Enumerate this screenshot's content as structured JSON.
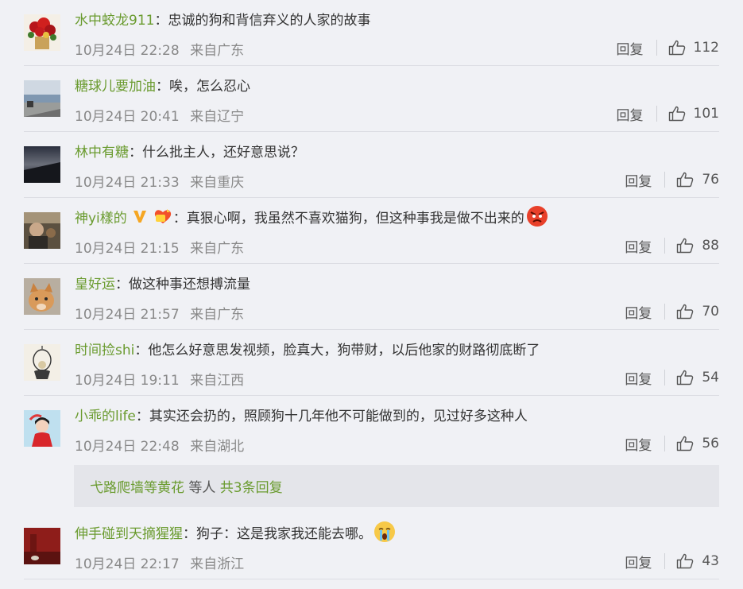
{
  "comments": [
    {
      "user": "水中蛟龙911",
      "text": "：忠诚的狗和背信弃义的人家的故事",
      "date": "10月24日 22:28",
      "location": "来自广东",
      "reply": "回复",
      "likes": "112",
      "avatar": "flowers-avatar"
    },
    {
      "user": "糖球儿要加油",
      "text": "：唉，怎么忍心",
      "date": "10月24日 20:41",
      "location": "来自辽宁",
      "reply": "回复",
      "likes": "101",
      "avatar": "seaside-avatar"
    },
    {
      "user": "林中有糖",
      "text": "：什么批主人，还好意思说？",
      "date": "10月24日 21:33",
      "location": "来自重庆",
      "reply": "回复",
      "likes": "76",
      "avatar": "sky-avatar"
    },
    {
      "user": "神yi樣的",
      "text": "：真狠心啊，我虽然不喜欢猫狗，但这种事我是做不出来的",
      "date": "10月24日 21:15",
      "location": "来自广东",
      "reply": "回复",
      "likes": "88",
      "avatar": "person-avatar"
    },
    {
      "user": "皇好运",
      "text": "：做这种事还想搏流量",
      "date": "10月24日 21:57",
      "location": "来自广东",
      "reply": "回复",
      "likes": "70",
      "avatar": "cat-avatar"
    },
    {
      "user": "时间捡shi",
      "text": "：他怎么好意思发视频，脸真大，狗带财，以后他家的财路彻底断了",
      "date": "10月24日 19:11",
      "location": "来自江西",
      "reply": "回复",
      "likes": "54",
      "avatar": "sketch-avatar"
    },
    {
      "user": "小乖的life",
      "text": "：其实还会扔的，照顾狗十几年他不可能做到的，见过好多这种人",
      "date": "10月24日 22:48",
      "location": "来自湖北",
      "reply": "回复",
      "likes": "56",
      "avatar": "girl-avatar"
    },
    {
      "user": "伸手碰到天摘猩猩",
      "text": "：狗子：这是我家我还能去哪。",
      "date": "10月24日 22:17",
      "location": "来自浙江",
      "reply": "回复",
      "likes": "43",
      "avatar": "redwall-avatar"
    }
  ],
  "subreply": {
    "names": "弋路爬墙等黄花",
    "middle": " 等人 ",
    "count": "共3条回复"
  },
  "colors": {
    "username": "#6a9b2f",
    "background": "#f0f1f5",
    "subreply_bg": "#e4e5ea",
    "meta": "#888888"
  }
}
